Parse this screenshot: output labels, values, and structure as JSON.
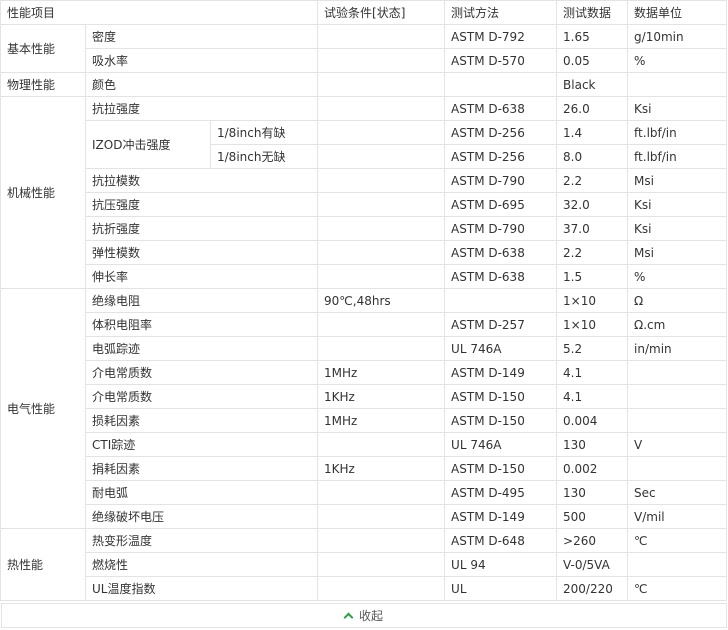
{
  "headers": {
    "item": "性能项目",
    "condition": "试验条件[状态]",
    "method": "测试方法",
    "data": "测试数据",
    "unit": "数据单位"
  },
  "categories": {
    "basic": "基本性能",
    "physical": "物理性能",
    "mechanical": "机械性能",
    "electrical": "电气性能",
    "thermal": "热性能"
  },
  "izod": {
    "name": "IZOD冲击强度",
    "notched": "1/8inch有缺",
    "unnotched": "1/8inch无缺"
  },
  "rows": [
    {
      "name": "密度",
      "cond": "",
      "method": "ASTM D-792",
      "value": "1.65",
      "unit": "g/10min"
    },
    {
      "name": "吸水率",
      "cond": "",
      "method": "ASTM D-570",
      "value": "0.05",
      "unit": "%"
    },
    {
      "name": "颜色",
      "cond": "",
      "method": "",
      "value": "Black",
      "unit": ""
    },
    {
      "name": "抗拉强度",
      "cond": "",
      "method": "ASTM D-638",
      "value": "26.0",
      "unit": "Ksi"
    },
    {
      "name": "",
      "cond": "",
      "method": "ASTM D-256",
      "value": "1.4",
      "unit": "ft.lbf/in"
    },
    {
      "name": "",
      "cond": "",
      "method": "ASTM D-256",
      "value": "8.0",
      "unit": "ft.lbf/in"
    },
    {
      "name": "抗拉模数",
      "cond": "",
      "method": "ASTM D-790",
      "value": "2.2",
      "unit": "Msi"
    },
    {
      "name": "抗压强度",
      "cond": "",
      "method": "ASTM D-695",
      "value": "32.0",
      "unit": "Ksi"
    },
    {
      "name": "抗折强度",
      "cond": "",
      "method": "ASTM D-790",
      "value": "37.0",
      "unit": "Ksi"
    },
    {
      "name": "弹性模数",
      "cond": "",
      "method": "ASTM D-638",
      "value": "2.2",
      "unit": "Msi"
    },
    {
      "name": "伸长率",
      "cond": "",
      "method": "ASTM D-638",
      "value": "1.5",
      "unit": "%"
    },
    {
      "name": "绝缘电阻",
      "cond": "90℃,48hrs",
      "method": "",
      "value": "1×10",
      "unit": "Ω"
    },
    {
      "name": "体积电阻率",
      "cond": "",
      "method": "ASTM D-257",
      "value": "1×10",
      "unit": "Ω.cm"
    },
    {
      "name": "电弧踪迹",
      "cond": "",
      "method": "UL 746A",
      "value": "5.2",
      "unit": "in/min"
    },
    {
      "name": "介电常质数",
      "cond": "1MHz",
      "method": "ASTM D-149",
      "value": "4.1",
      "unit": ""
    },
    {
      "name": "介电常质数",
      "cond": "1KHz",
      "method": "ASTM D-150",
      "value": "4.1",
      "unit": ""
    },
    {
      "name": "损耗因素",
      "cond": "1MHz",
      "method": "ASTM D-150",
      "value": "0.004",
      "unit": ""
    },
    {
      "name": "CTI踪迹",
      "cond": "",
      "method": "UL 746A",
      "value": "130",
      "unit": "V"
    },
    {
      "name": "捐耗因素",
      "cond": "1KHz",
      "method": "ASTM D-150",
      "value": "0.002",
      "unit": ""
    },
    {
      "name": "耐电弧",
      "cond": "",
      "method": "ASTM D-495",
      "value": "130",
      "unit": "Sec"
    },
    {
      "name": "绝缘破坏电压",
      "cond": "",
      "method": "ASTM D-149",
      "value": "500",
      "unit": "V/mil"
    },
    {
      "name": "热变形温度",
      "cond": "",
      "method": "ASTM D-648",
      "value": ">260",
      "unit": "℃"
    },
    {
      "name": "燃烧性",
      "cond": "",
      "method": "UL 94",
      "value": "V-0/5VA",
      "unit": ""
    },
    {
      "name": "UL温度指数",
      "cond": "",
      "method": "UL",
      "value": "200/220",
      "unit": "℃"
    }
  ],
  "collapse_label": "收起"
}
